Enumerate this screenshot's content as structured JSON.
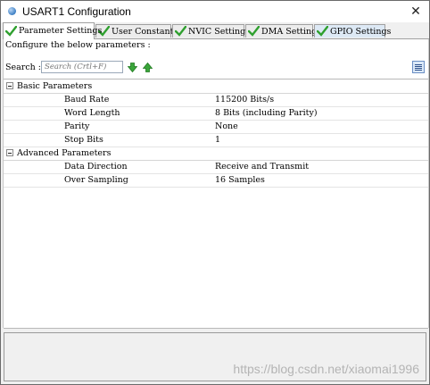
{
  "window": {
    "title": "USART1 Configuration",
    "close_glyph": "✕"
  },
  "tabs": [
    {
      "label": "Parameter Settings",
      "icon": "green-check-icon",
      "active": true
    },
    {
      "label": "User Constants",
      "icon": "green-check-icon",
      "active": false
    },
    {
      "label": "NVIC Settings",
      "icon": "green-check-icon",
      "active": false
    },
    {
      "label": "DMA Settings",
      "icon": "green-check-icon",
      "active": false
    },
    {
      "label": "GPIO Settings",
      "icon": "green-check-icon",
      "active": false
    }
  ],
  "instructions": "Configure the below parameters :",
  "search": {
    "label": "Search :",
    "placeholder": "Search (Crtl+F)"
  },
  "groups": [
    {
      "label": "Basic Parameters",
      "params": [
        {
          "name": "Baud Rate",
          "value": "115200 Bits/s"
        },
        {
          "name": "Word Length",
          "value": "8 Bits (including Parity)"
        },
        {
          "name": "Parity",
          "value": "None"
        },
        {
          "name": "Stop Bits",
          "value": "1"
        }
      ]
    },
    {
      "label": "Advanced Parameters",
      "params": [
        {
          "name": "Data Direction",
          "value": "Receive and Transmit"
        },
        {
          "name": "Over Sampling",
          "value": "16 Samples"
        }
      ]
    }
  ],
  "watermark": "https://blog.csdn.net/xiaomai1996",
  "colors": {
    "check_green": "#2fa02f",
    "arrow_green": "#3aa53a",
    "selected_tab_bg": "#ffffff"
  }
}
